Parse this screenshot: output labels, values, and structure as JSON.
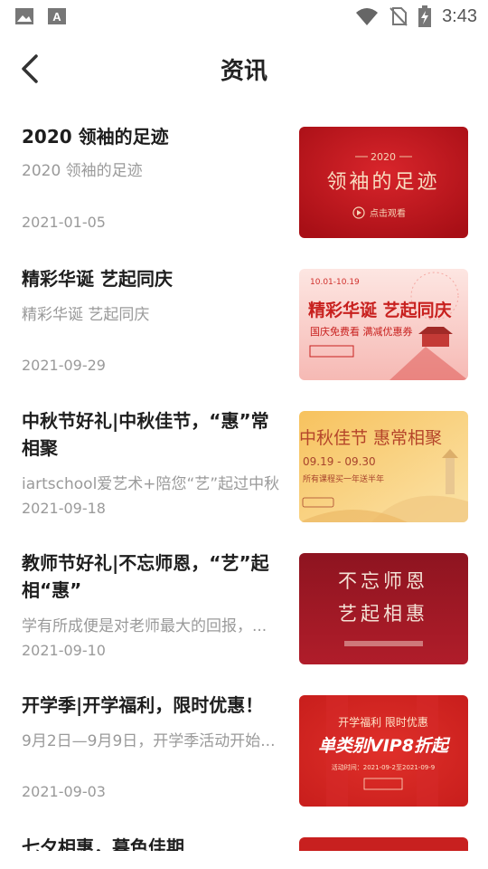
{
  "status_bar": {
    "time": "3:43"
  },
  "header": {
    "title": "资讯"
  },
  "articles": [
    {
      "title": "2020 领袖的足迹",
      "summary": "2020 领袖的足迹",
      "date": "2021-01-05",
      "thumb": {
        "line1": "2020",
        "line2": "领袖的足迹",
        "line3": "点击观看"
      }
    },
    {
      "title": "精彩华诞 艺起同庆",
      "summary": "精彩华诞 艺起同庆",
      "date": "2021-09-29",
      "thumb": {
        "line1": "10.01-10.19",
        "line2": "精彩华诞 艺起同庆",
        "line3": "国庆免费看  满减优惠券"
      }
    },
    {
      "title": "中秋节好礼|中秋佳节，“惠”常相聚",
      "summary": "iartschool爱艺术+陪您“艺”起过中秋",
      "date": "2021-09-18",
      "thumb": {
        "line1": "中秋佳节 惠常相聚",
        "line2": "09.19 - 09.30",
        "line3": "所有课程买一年送半年"
      }
    },
    {
      "title": "教师节好礼|不忘师恩，“艺”起相“惠”",
      "summary": "学有所成便是对老师最大的回报，...",
      "date": "2021-09-10",
      "thumb": {
        "line1": "不忘师恩",
        "line2": "艺起相惠"
      }
    },
    {
      "title": "开学季|开学福利，限时优惠！",
      "summary": "9月2日—9月9日，开学季活动开始...",
      "date": "2021-09-03",
      "thumb": {
        "line1": "开学福利 限时优惠",
        "line2": "单类别VIP8折起",
        "line3": "活动时间：2021-09-2至2021-09-9"
      }
    },
    {
      "title": "七夕相惠，暮色佳期",
      "summary": "",
      "date": "",
      "thumb": {}
    }
  ]
}
